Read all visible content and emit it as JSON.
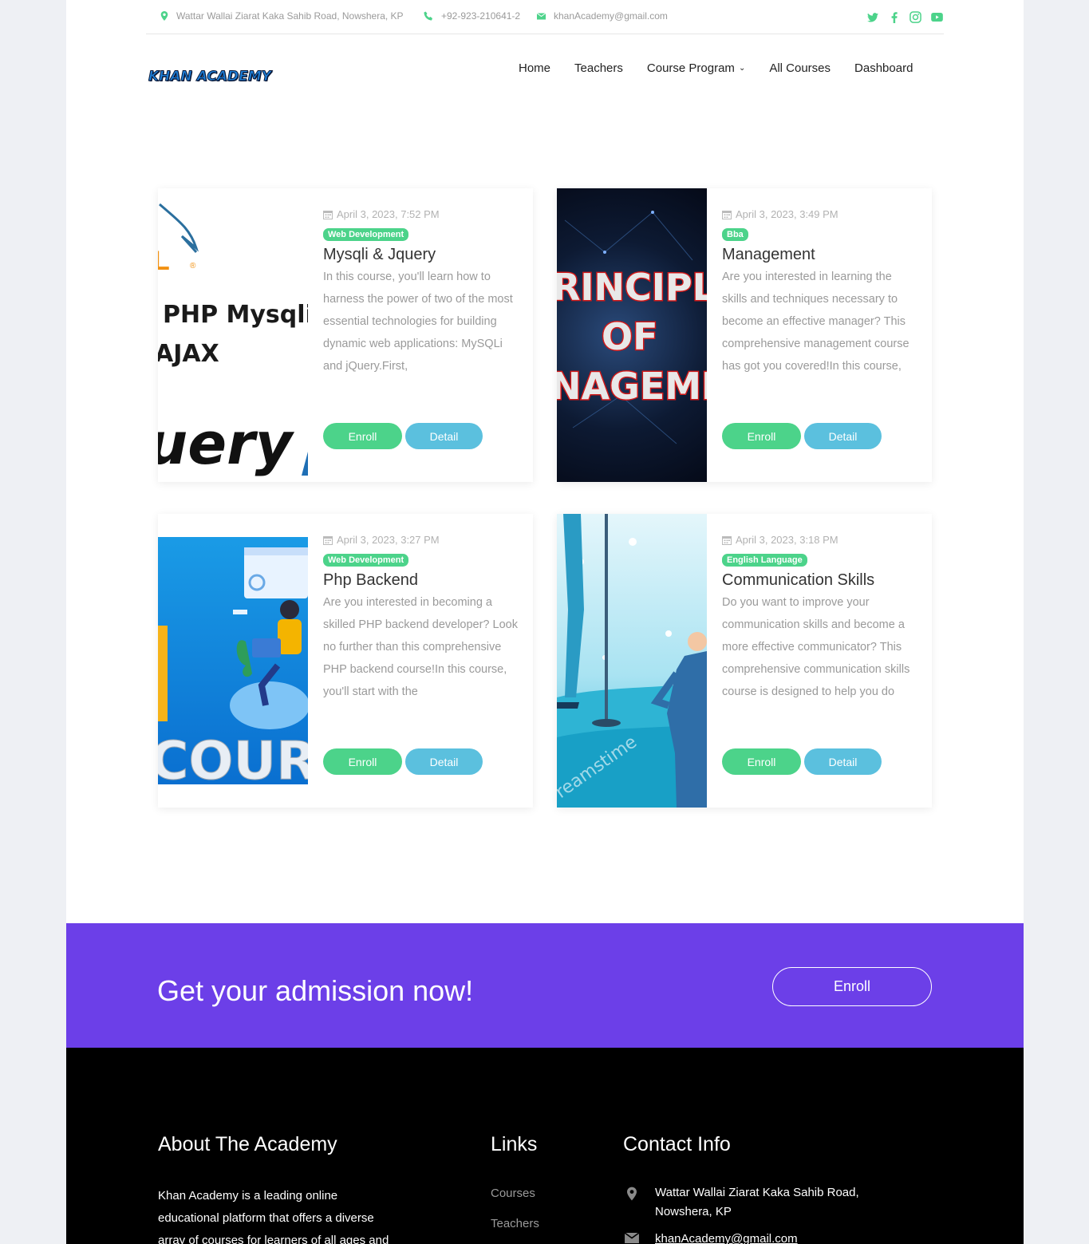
{
  "topbar": {
    "address": "Wattar Wallai Ziarat Kaka Sahib Road, Nowshera, KP",
    "phone": "+92-923-210641-2",
    "email": "khanAcademy@gmail.com",
    "accent_color": "#4cd38a"
  },
  "header": {
    "logo": "KHAN ACADEMY",
    "nav": [
      "Home",
      "Teachers",
      "Course Program",
      "All Courses",
      "Dashboard"
    ]
  },
  "courses": [
    {
      "date": "April 3, 2023, 7:52 PM",
      "category": "Web Development",
      "title": "Mysqli & Jquery",
      "description": "In this course, you'll learn how to harness the power of two of the most essential technologies for building dynamic web applications: MySQLi and jQuery.First,",
      "thumb_text": [
        "PHP Mysqli",
        "AJAX",
        "uery"
      ],
      "enroll": "Enroll",
      "detail": "Detail"
    },
    {
      "date": "April 3, 2023, 3:49 PM",
      "category": "Bba",
      "title": "Management",
      "description": "Are you interested in learning the skills and techniques necessary to become an effective manager? This comprehensive management course has got you covered!In this course,",
      "thumb_text": [
        "RINCIPL",
        "OF",
        "NAGEMI"
      ],
      "enroll": "Enroll",
      "detail": "Detail"
    },
    {
      "date": "April 3, 2023, 3:27 PM",
      "category": "Web Development",
      "title": "Php Backend",
      "description": "Are you interested in becoming a skilled PHP backend developer? Look no further than this comprehensive PHP backend course!In this course, you'll start with the",
      "thumb_text": [
        "COUR"
      ],
      "enroll": "Enroll",
      "detail": "Detail"
    },
    {
      "date": "April 3, 2023, 3:18 PM",
      "category": "English Language",
      "title": "Communication Skills",
      "description": "Do you want to improve your communication skills and become a more effective communicator? This comprehensive communication skills course is designed to help you do",
      "thumb_text": [
        "reamstime"
      ],
      "enroll": "Enroll",
      "detail": "Detail"
    }
  ],
  "cta": {
    "heading": "Get your admission now!",
    "button": "Enroll",
    "bg_color": "#6c3fe8"
  },
  "footer": {
    "about_title": "About The Academy",
    "about_text": "Khan Academy is a leading online educational platform that offers a diverse array of courses for learners of all ages and",
    "links_title": "Links",
    "links": [
      "Courses",
      "Teachers"
    ],
    "contact_title": "Contact Info",
    "contact_address": "Wattar Wallai Ziarat Kaka Sahib Road, Nowshera, KP",
    "contact_email": "khanAcademy@gmail.com"
  }
}
